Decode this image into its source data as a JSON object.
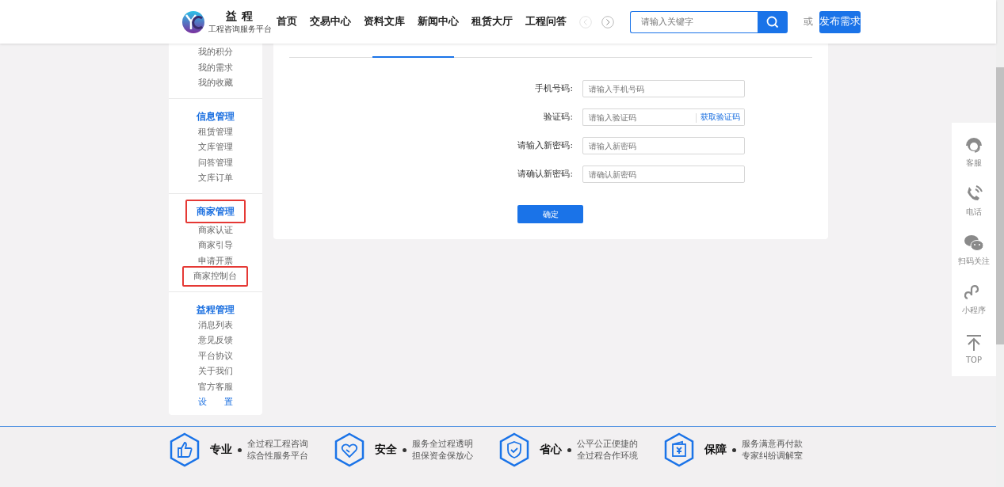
{
  "header": {
    "logo_title": "益 程",
    "logo_subtitle": "工程咨询服务平台",
    "nav": [
      {
        "label": "首页"
      },
      {
        "label": "交易中心"
      },
      {
        "label": "资料文库"
      },
      {
        "label": "新闻中心"
      },
      {
        "label": "租赁大厅"
      },
      {
        "label": "工程问答"
      }
    ],
    "search": {
      "placeholder": "请输入关键字"
    },
    "or_text": "或",
    "publish_button": "发布需求"
  },
  "sidebar": [
    {
      "items": [
        {
          "label": "我的积分",
          "kind": "plain",
          "highlighted": false
        },
        {
          "label": "我的需求",
          "kind": "plain",
          "highlighted": false
        },
        {
          "label": "我的收藏",
          "kind": "plain",
          "highlighted": false
        }
      ]
    },
    {
      "title": "信息管理",
      "title_highlighted": false,
      "items": [
        {
          "label": "租赁管理",
          "kind": "plain",
          "highlighted": false
        },
        {
          "label": "文库管理",
          "kind": "plain",
          "highlighted": false
        },
        {
          "label": "问答管理",
          "kind": "plain",
          "highlighted": false
        },
        {
          "label": "文库订单",
          "kind": "plain",
          "highlighted": false
        }
      ]
    },
    {
      "title": "商家管理",
      "title_highlighted": true,
      "items": [
        {
          "label": "商家认证",
          "kind": "plain",
          "highlighted": false
        },
        {
          "label": "商家引导",
          "kind": "plain",
          "highlighted": false
        },
        {
          "label": "申请开票",
          "kind": "plain",
          "highlighted": false
        },
        {
          "label": "商家控制台",
          "kind": "plain",
          "highlighted": true
        }
      ]
    },
    {
      "title": "益程管理",
      "title_highlighted": false,
      "items": [
        {
          "label": "消息列表",
          "kind": "plain",
          "highlighted": false
        },
        {
          "label": "意见反馈",
          "kind": "plain",
          "highlighted": false
        },
        {
          "label": "平台协议",
          "kind": "plain",
          "highlighted": false
        },
        {
          "label": "关于我们",
          "kind": "plain",
          "highlighted": false
        },
        {
          "label": "官方客服",
          "kind": "plain",
          "highlighted": false
        },
        {
          "label": "设　　置",
          "kind": "link",
          "highlighted": false
        }
      ]
    }
  ],
  "form": {
    "fields": [
      {
        "label": "手机号码:",
        "placeholder": "请输入手机号码"
      },
      {
        "label": "验证码:",
        "placeholder": "请输入验证码",
        "action": "获取验证码"
      },
      {
        "label": "请输入新密码:",
        "placeholder": "请输入新密码"
      },
      {
        "label": "请确认新密码:",
        "placeholder": "请确认新密码"
      }
    ],
    "submit": "确定"
  },
  "float_bar": [
    {
      "kind": "headset",
      "label": "客服"
    },
    {
      "kind": "phone",
      "label": "电话"
    },
    {
      "kind": "chat",
      "label": "扫码关注"
    },
    {
      "kind": "loop",
      "label": "小程序"
    },
    {
      "kind": "top",
      "label": "TOP"
    }
  ],
  "footer": [
    {
      "kind": "thumb",
      "title": "专业",
      "lines": [
        "全过程工程咨询",
        "综合性服务平台"
      ]
    },
    {
      "kind": "heart",
      "title": "安全",
      "lines": [
        "服务全过程透明",
        "担保资金保放心"
      ]
    },
    {
      "kind": "shield",
      "title": "省心",
      "lines": [
        "公平公正便捷的",
        "全过程合作环境"
      ]
    },
    {
      "kind": "wallet",
      "title": "保障",
      "lines": [
        "服务满意再付款",
        "专家纠纷调解室"
      ]
    }
  ]
}
